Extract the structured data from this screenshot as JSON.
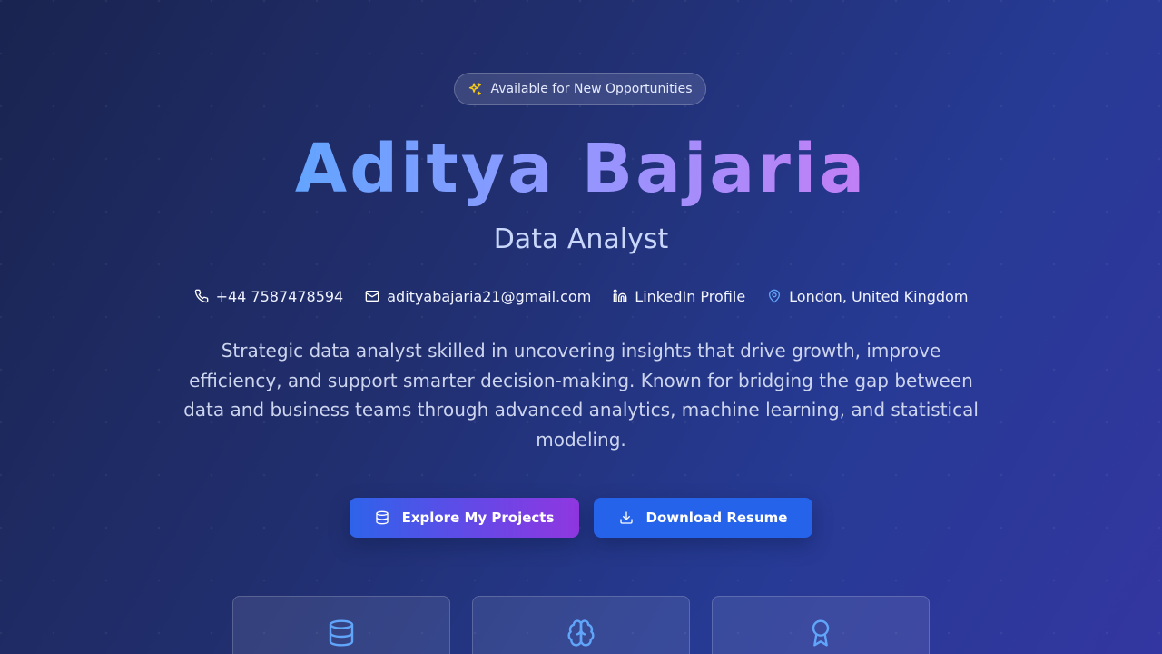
{
  "hero": {
    "badge": {
      "icon": "sparkles-icon",
      "label": "Available for New Opportunities",
      "icon_color": "#facc15"
    },
    "name": "Aditya Bajaria",
    "role": "Data Analyst",
    "contacts": [
      {
        "icon": "phone-icon",
        "label": "+44 7587478594"
      },
      {
        "icon": "mail-icon",
        "label": "adityabajaria21@gmail.com"
      },
      {
        "icon": "linkedin-icon",
        "label": "LinkedIn Profile"
      },
      {
        "icon": "map-pin-icon",
        "label": "London, United Kingdom"
      }
    ],
    "summary": "Strategic data analyst skilled in uncovering insights that drive growth, improve efficiency, and support smarter decision-making. Known for bridging the gap between data and business teams through advanced analytics, machine learning, and statistical modeling.",
    "buttons": {
      "projects": {
        "icon": "database-icon",
        "label": "Explore My Projects"
      },
      "resume": {
        "icon": "download-icon",
        "label": "Download Resume"
      }
    }
  },
  "cards": [
    {
      "icon": "database-icon"
    },
    {
      "icon": "brain-icon"
    },
    {
      "icon": "award-icon"
    }
  ],
  "colors": {
    "accent_blue": "#2563eb",
    "accent_purple": "#9333ea",
    "name_gradient_start": "#60a5fa",
    "name_gradient_end": "#c084fc",
    "card_icon": "#60a5fa"
  }
}
